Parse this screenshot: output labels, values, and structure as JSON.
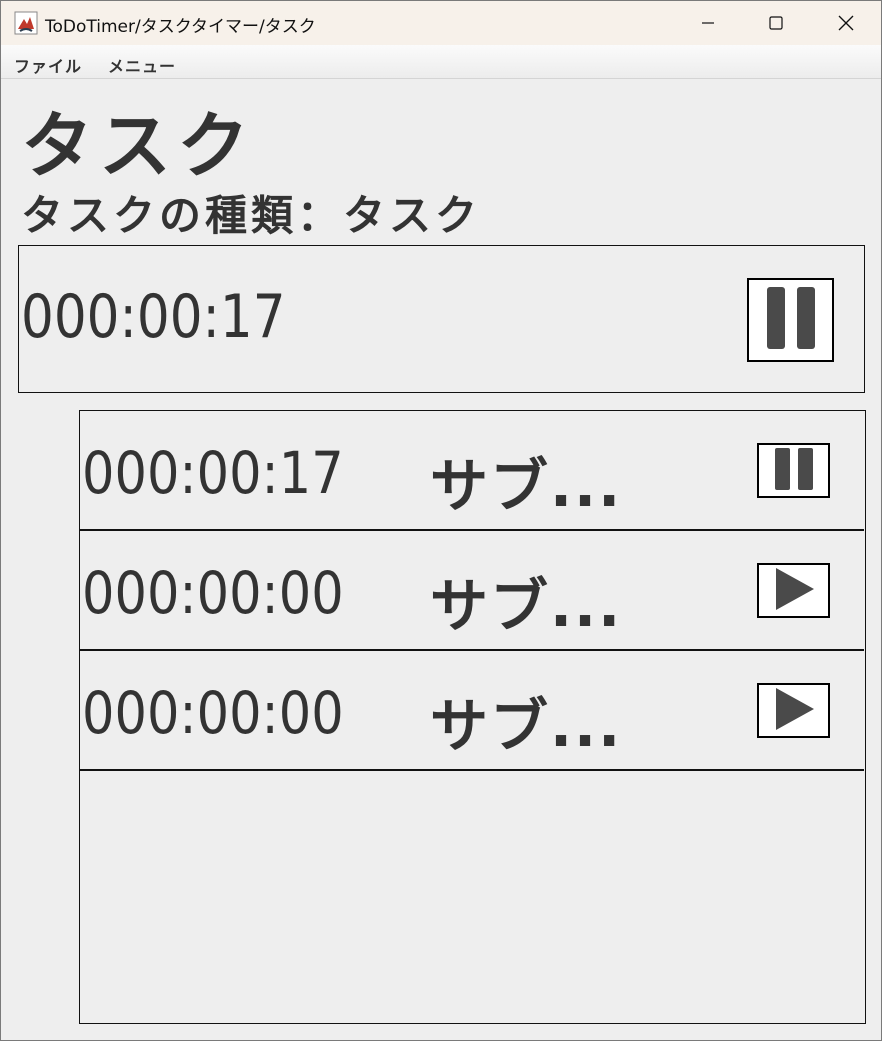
{
  "window": {
    "title": "ToDoTimer/タスクタイマー/タスク",
    "minimize_icon": "minimize-icon",
    "maximize_icon": "maximize-icon",
    "close_icon": "close-icon"
  },
  "menu": {
    "items": [
      {
        "label": "ファイル"
      },
      {
        "label": "メニュー"
      }
    ]
  },
  "task": {
    "title": "タスク",
    "type_label": "タスクの種類：タスク",
    "timer": "000:00:17",
    "state": "running",
    "button_icon": "pause-icon"
  },
  "subtasks": [
    {
      "timer": "000:00:17",
      "name": "サブ...",
      "state": "running",
      "button_icon": "pause-icon"
    },
    {
      "timer": "000:00:00",
      "name": "サブ...",
      "state": "stopped",
      "button_icon": "play-icon"
    },
    {
      "timer": "000:00:00",
      "name": "サブ...",
      "state": "stopped",
      "button_icon": "play-icon"
    }
  ],
  "colors": {
    "text": "#333333",
    "background": "#eeeeee",
    "titlebar": "#f7f1ea",
    "icon_fill": "#4a4a4a"
  }
}
